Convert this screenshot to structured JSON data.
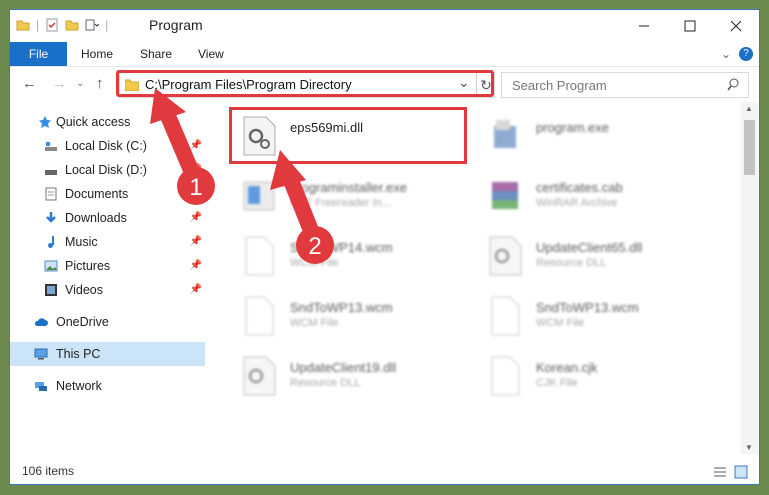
{
  "window": {
    "title": "Program"
  },
  "ribbon": {
    "file": "File",
    "home": "Home",
    "share": "Share",
    "view": "View",
    "help": "?"
  },
  "address": {
    "path": "C:\\Program Files\\Program Directory",
    "refresh": "↻",
    "dropdown": "⌄"
  },
  "search": {
    "placeholder": "Search Program"
  },
  "nav": {
    "back": "←",
    "forward": "→",
    "up": "↑",
    "items": [
      {
        "label": "Quick access",
        "icon": "star-icon"
      },
      {
        "label": "Local Disk (C:)",
        "icon": "drive-icon",
        "pinned": true
      },
      {
        "label": "Local Disk (D:)",
        "icon": "drive-icon",
        "pinned": true
      },
      {
        "label": "Documents",
        "icon": "documents-icon",
        "pinned": true
      },
      {
        "label": "Downloads",
        "icon": "download-icon",
        "pinned": true
      },
      {
        "label": "Music",
        "icon": "music-icon",
        "pinned": true
      },
      {
        "label": "Pictures",
        "icon": "pictures-icon",
        "pinned": true
      },
      {
        "label": "Videos",
        "icon": "video-icon",
        "pinned": true
      },
      {
        "label": "OneDrive",
        "icon": "cloud-icon"
      },
      {
        "label": "This PC",
        "icon": "computer-icon",
        "selected": true
      },
      {
        "label": "Network",
        "icon": "network-icon"
      }
    ]
  },
  "files": [
    {
      "name": "eps569mi.dll",
      "desc": ""
    },
    {
      "name": "program.exe",
      "desc": ""
    },
    {
      "name": "programinstaller.exe",
      "desc": "PDF Freereader In..."
    },
    {
      "name": "certificates.cab",
      "desc": "WinRAR Archive"
    },
    {
      "name": "SndToWP14.wcm",
      "desc": "WCM File"
    },
    {
      "name": "UpdateClient65.dll",
      "desc": "Resource DLL"
    },
    {
      "name": "SndToWP13.wcm",
      "desc": "WCM File"
    },
    {
      "name": "SndToWP13.wcm",
      "desc": "WCM File"
    },
    {
      "name": "UpdateClient19.dll",
      "desc": "Resource DLL"
    },
    {
      "name": "Korean.cjk",
      "desc": "CJK File"
    }
  ],
  "status": {
    "count": "106 items"
  },
  "annotations": {
    "step1": "1",
    "step2": "2"
  },
  "colors": {
    "accent": "#1a6fc9",
    "highlight": "#e0393e",
    "selected": "#cce4f7"
  }
}
